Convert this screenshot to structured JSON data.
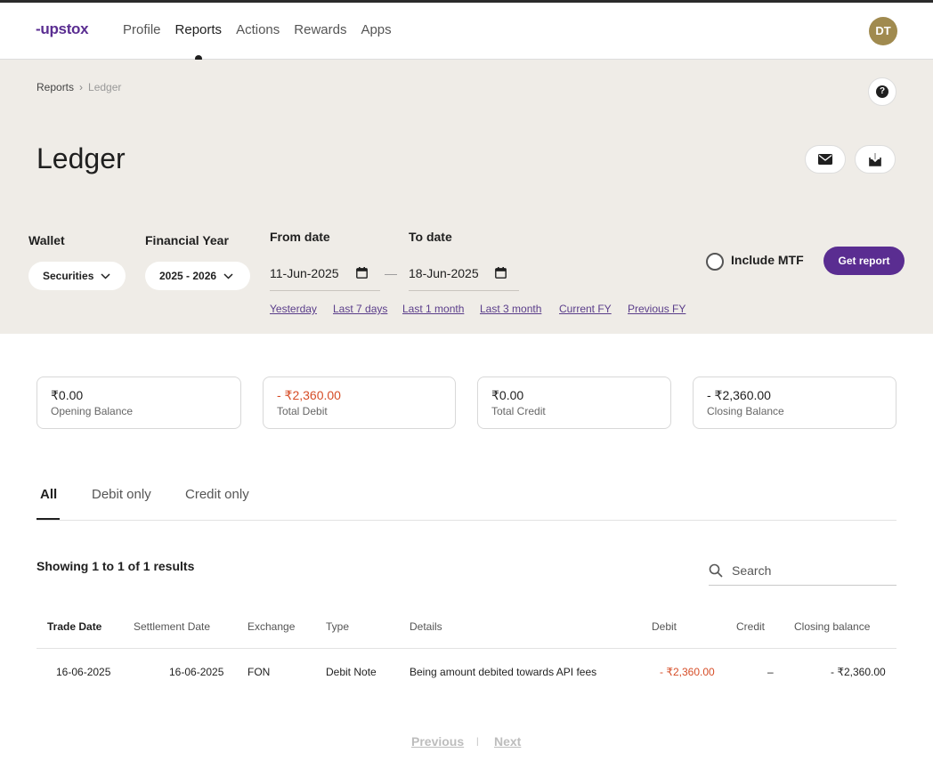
{
  "header": {
    "logo": "upstox",
    "nav": [
      "Profile",
      "Reports",
      "Actions",
      "Rewards",
      "Apps"
    ],
    "active_nav": "Reports",
    "avatar_initials": "DT"
  },
  "breadcrumb": {
    "root": "Reports",
    "separator": "›",
    "current": "Ledger"
  },
  "page_title": "Ledger",
  "filters": {
    "wallet_label": "Wallet",
    "wallet_value": "Securities",
    "fy_label": "Financial Year",
    "fy_value": "2025 - 2026",
    "from_label": "From date",
    "from_value": "11-Jun-2025",
    "to_label": "To date",
    "to_value": "18-Jun-2025",
    "dash": "—",
    "quick_ranges": [
      "Yesterday",
      "Last 7 days",
      "Last 1 month",
      "Last 3 month",
      "Current FY",
      "Previous FY"
    ],
    "mtf_label": "Include MTF",
    "get_report": "Get report"
  },
  "summary": [
    {
      "value": "₹0.00",
      "label": "Opening Balance"
    },
    {
      "value": "- ₹2,360.00",
      "label": "Total Debit"
    },
    {
      "value": "₹0.00",
      "label": "Total Credit"
    },
    {
      "value": "- ₹2,360.00",
      "label": "Closing Balance"
    }
  ],
  "tabs": [
    "All",
    "Debit only",
    "Credit only"
  ],
  "active_tab": "All",
  "showing": "Showing 1 to 1 of 1 results",
  "search_placeholder": "Search",
  "table": {
    "columns": [
      "Trade Date",
      "Settlement Date",
      "Exchange",
      "Type",
      "Details",
      "Debit",
      "Credit",
      "Closing balance"
    ],
    "rows": [
      [
        "16-06-2025",
        "16-06-2025",
        "FON",
        "Debit Note",
        "Being amount debited towards API fees",
        "- ₹2,360.00",
        "–",
        "- ₹2,360.00"
      ]
    ]
  },
  "pagination": {
    "previous": "Previous",
    "separator": "|",
    "next": "Next"
  },
  "colors": {
    "brand": "#5a2d91",
    "negative": "#d64d27",
    "band": "#efece7",
    "avatar": "#a08a4f"
  }
}
